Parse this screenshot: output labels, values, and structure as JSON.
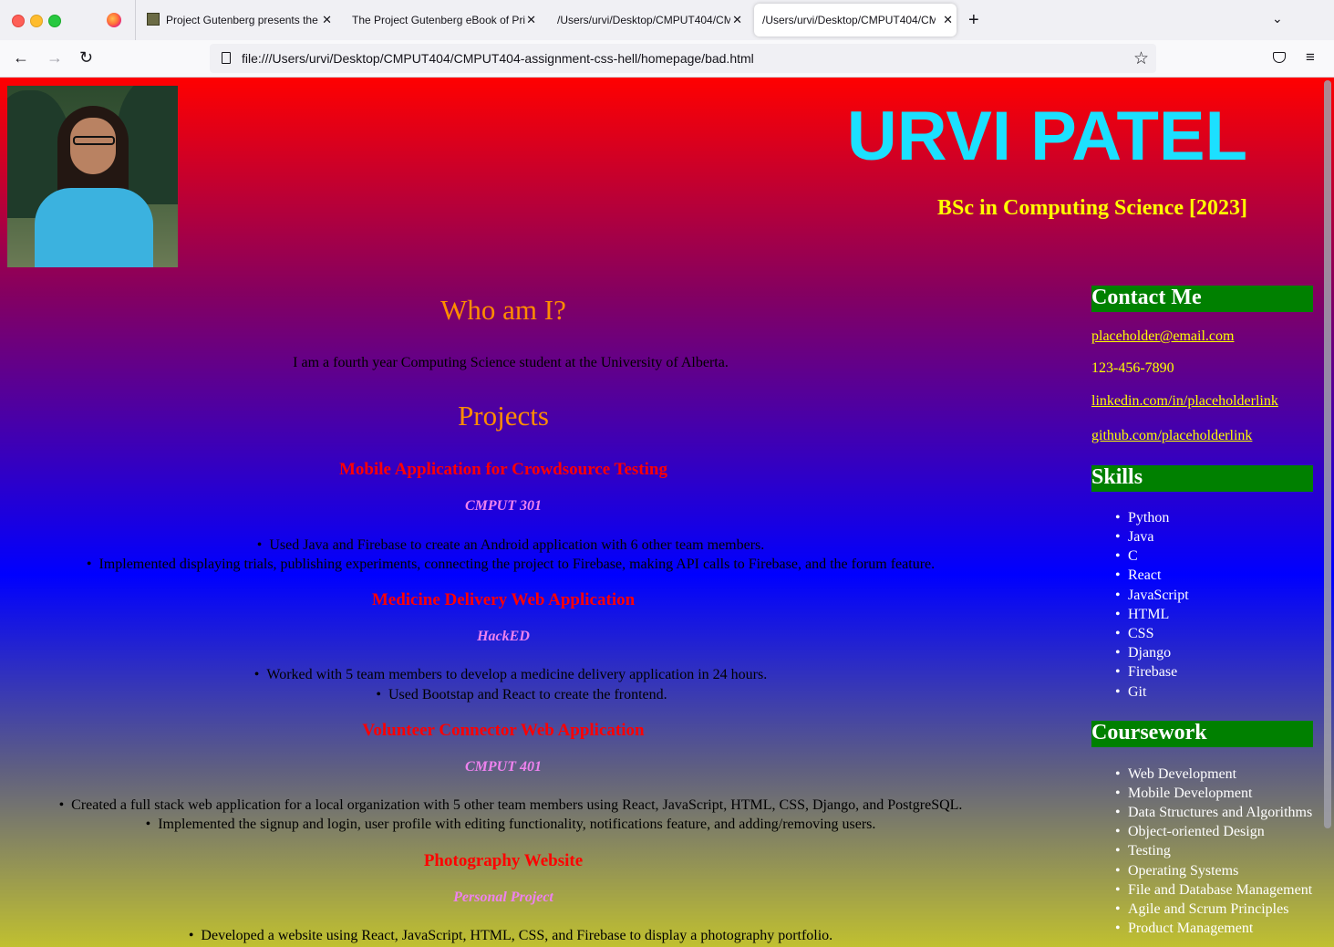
{
  "browser": {
    "tabs": [
      {
        "label": "Project Gutenberg presents the"
      },
      {
        "label": "The Project Gutenberg eBook of Pric"
      },
      {
        "label": "/Users/urvi/Desktop/CMPUT404/CM"
      },
      {
        "label": "/Users/urvi/Desktop/CMPUT404/CM"
      }
    ],
    "url": "file:///Users/urvi/Desktop/CMPUT404/CMPUT404-assignment-css-hell/homepage/bad.html",
    "icons": {
      "back": "arrow-left-icon",
      "forward": "arrow-right-icon",
      "reload": "reload-icon",
      "bookmark": "star-icon",
      "pocket": "pocket-icon",
      "menu": "hamburger-menu-icon",
      "new_tab": "plus-icon",
      "tab_list": "chevron-down-icon",
      "tab_close": "close-icon"
    },
    "glyphs": {
      "back": "←",
      "forward": "→",
      "reload": "↻",
      "star": "☆",
      "close": "✕",
      "plus": "+",
      "chevron": "⌄",
      "menu": "≡"
    }
  },
  "header": {
    "name": "URVI PATEL",
    "degree": "BSc in Computing Science [2023]"
  },
  "main": {
    "about_heading": "Who am I?",
    "about_text": "I am a fourth year Computing Science student at the University of Alberta.",
    "projects_heading": "Projects",
    "projects": [
      {
        "title": "Mobile Application for Crowdsource Testing",
        "subtitle": "CMPUT 301",
        "bullets": [
          "Used Java and Firebase to create an Android application with 6 other team members.",
          "Implemented displaying trials, publishing experiments, connecting the project to Firebase, making API calls to Firebase, and the forum feature."
        ]
      },
      {
        "title": "Medicine Delivery Web Application",
        "subtitle": "HackED",
        "bullets": [
          "Worked with 5 team members to develop a medicine delivery application in 24 hours.",
          "Used Bootstap and React to create the frontend."
        ]
      },
      {
        "title": "Volunteer Connector Web Application",
        "subtitle": "CMPUT 401",
        "bullets": [
          "Created a full stack web application for a local organization with 5 other team members using React, JavaScript, HTML, CSS, Django, and PostgreSQL.",
          "Implemented the signup and login, user profile with editing functionality, notifications feature, and adding/removing users."
        ]
      },
      {
        "title": "Photography Website",
        "subtitle": "Personal Project",
        "bullets": [
          "Developed a website using React, JavaScript, HTML, CSS, and Firebase to display a photography portfolio."
        ]
      }
    ]
  },
  "sidebar": {
    "contact_heading": "Contact Me",
    "email": "placeholder@email.com",
    "phone": "123-456-7890",
    "linkedin": "linkedin.com/in/placeholderlink",
    "github": "github.com/placeholderlink",
    "skills_heading": "Skills",
    "skills": [
      "Python",
      "Java",
      "C",
      "React",
      "JavaScript",
      "HTML",
      "CSS",
      "Django",
      "Firebase",
      "Git"
    ],
    "coursework_heading": "Coursework",
    "coursework": [
      "Web Development",
      "Mobile Development",
      "Data Structures and Algorithms",
      "Object-oriented Design",
      "Testing",
      "Operating Systems",
      "File and Database Management",
      "Agile and Scrum Principles",
      "Product Management"
    ]
  },
  "colors": {
    "name": "#1ce0ff",
    "degree": "#ffff00",
    "section_heading": "#ff8c00",
    "project_title": "#ff0000",
    "project_subtitle": "#ee82ee",
    "sidebar_heading_bg": "#008000",
    "contact_text": "#ffff00",
    "list_text": "#ffffff"
  }
}
